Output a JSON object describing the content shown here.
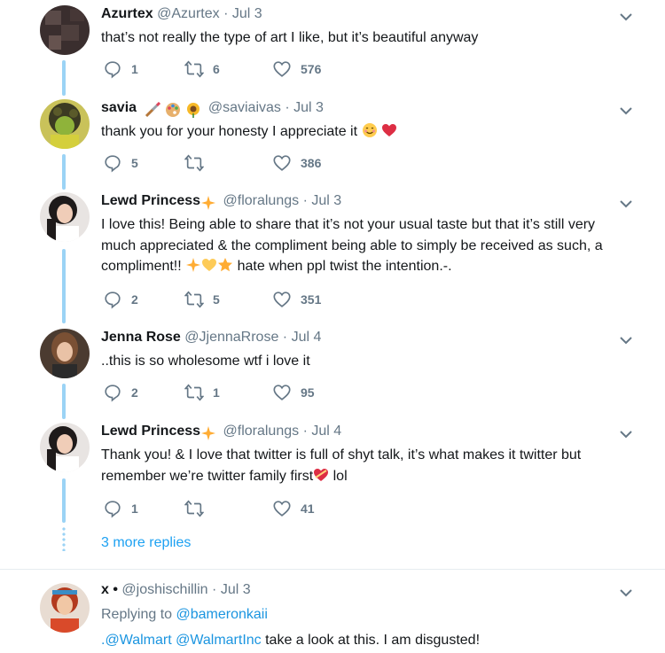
{
  "tweets": [
    {
      "name": "Azurtex",
      "handle": "@Azurtex",
      "dot": "·",
      "date": "Jul 3",
      "text": "that’s not really the type of art I like, but it’s beautiful anyway",
      "replies": "1",
      "retweets": "6",
      "likes": "576"
    },
    {
      "name": "savia",
      "handle": "@saviaivas",
      "dot": "·",
      "date": "Jul 3",
      "text": "thank you for your honesty I appreciate it",
      "replies": "5",
      "retweets": "",
      "likes": "386"
    },
    {
      "name": "Lewd Princess",
      "handle": "@floralungs",
      "dot": "·",
      "date": "Jul 3",
      "text_line1": "I love this! Being able to share that it’s not your usual taste but that it’s still very",
      "text_line2": "much appreciated & the compliment being able to simply be received as such, a",
      "text_line3a": "compliment!!",
      "text_line3b": "hate when ppl twist the intention.-.",
      "replies": "2",
      "retweets": "5",
      "likes": "351"
    },
    {
      "name": "Jenna Rose",
      "handle": "@JjennaRrose",
      "dot": "·",
      "date": "Jul 4",
      "text": "..this is so wholesome wtf i love it",
      "replies": "2",
      "retweets": "1",
      "likes": "95"
    },
    {
      "name": "Lewd Princess",
      "handle": "@floralungs",
      "dot": "·",
      "date": "Jul 4",
      "text_line1": "Thank you! & I love that twitter is full of shyt talk, it’s what makes it twitter but",
      "text_line2a": "remember we’re twitter family first",
      "text_line2b": "lol",
      "replies": "1",
      "retweets": "",
      "likes": "41"
    },
    {
      "name": "x •",
      "handle": "@joshischillin",
      "dot": "·",
      "date": "Jul 3",
      "replying_prefix": "Replying to",
      "replying_to": "@bameronkaii",
      "mention1": ".@Walmart",
      "mention2": "@WalmartInc",
      "text": "take a look at this. I am disgusted!"
    }
  ],
  "more_replies": "3 more replies",
  "icons": {
    "reply": "reply-icon",
    "retweet": "retweet-icon",
    "like": "heart-icon",
    "caret": "chevron-down-icon"
  },
  "colors": {
    "link": "#1da1f2",
    "thread": "#9bd3f5",
    "muted": "#657786"
  }
}
